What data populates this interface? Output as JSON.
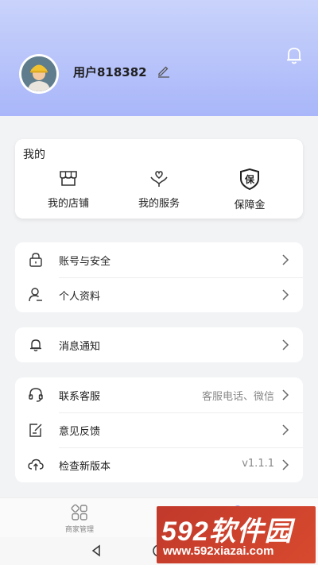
{
  "header": {
    "username": "用户818382",
    "colors": {
      "gradient_top": "#c9d3fb",
      "gradient_bottom": "#a9b6f9"
    }
  },
  "mine": {
    "title": "我的",
    "items": [
      {
        "label": "我的店铺",
        "icon": "store-icon"
      },
      {
        "label": "我的服务",
        "icon": "heart-hand-icon"
      },
      {
        "label": "保障金",
        "icon": "shield-bao-icon",
        "icon_text": "保"
      }
    ]
  },
  "group1": [
    {
      "label": "账号与安全",
      "icon": "lock-icon"
    },
    {
      "label": "个人资料",
      "icon": "user-edit-icon"
    }
  ],
  "group2": [
    {
      "label": "消息通知",
      "icon": "bell-icon"
    }
  ],
  "group3": [
    {
      "label": "联系客服",
      "icon": "headset-icon",
      "value": "客服电话、微信"
    },
    {
      "label": "意见反馈",
      "icon": "feedback-icon",
      "value": ""
    },
    {
      "label": "检查新版本",
      "icon": "cloud-upload-icon",
      "value": "v1.1.1"
    }
  ],
  "tabbar": {
    "tabs": [
      {
        "label": "商家管理",
        "icon": "grid-icon"
      }
    ]
  },
  "watermark": {
    "big": "592软件园",
    "small": "www.592xiazai.com"
  }
}
